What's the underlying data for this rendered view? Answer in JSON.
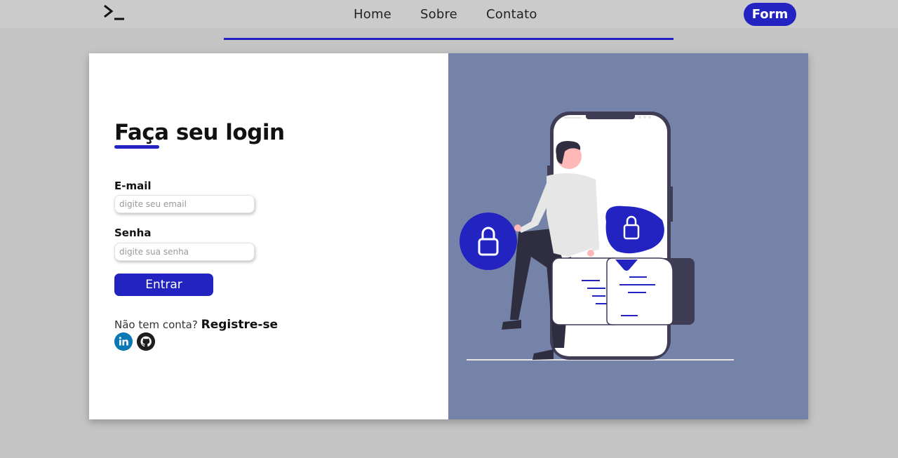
{
  "navbar": {
    "logo_icon": "terminal-prompt-icon",
    "links": [
      {
        "label": "Home"
      },
      {
        "label": "Sobre"
      },
      {
        "label": "Contato"
      }
    ],
    "cta_label": "Form",
    "accent_color": "#2323c2"
  },
  "login": {
    "title": "Faça seu login",
    "email_label": "E-mail",
    "email_placeholder": "digite seu email",
    "password_label": "Senha",
    "password_placeholder": "digite sua senha",
    "submit_label": "Entrar",
    "register_prompt": "Não tem conta?",
    "register_link": "Registre-se",
    "social": [
      {
        "icon": "linkedin-icon"
      },
      {
        "icon": "github-icon"
      }
    ]
  },
  "colors": {
    "panel_bg": "#7483a7",
    "accent": "#2323c2",
    "page_bg": "#c4c4c4"
  }
}
